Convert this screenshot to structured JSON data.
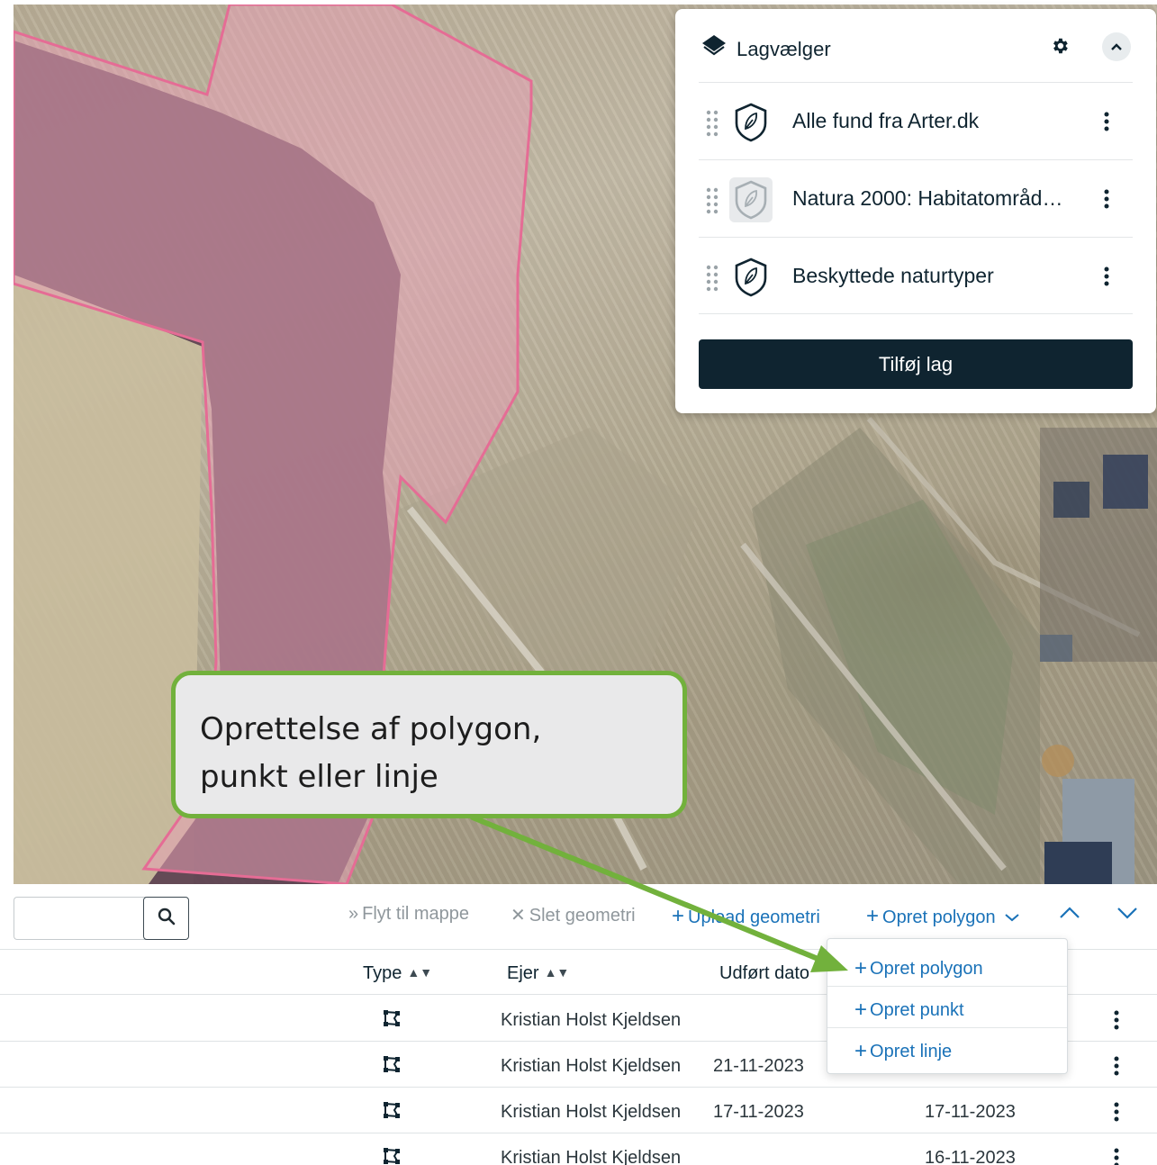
{
  "layer_panel": {
    "title": "Lagvælger",
    "layers": [
      {
        "name": "Alle fund fra Arter.dk",
        "icon": "shield-leaf-icon",
        "dimmed": false
      },
      {
        "name": "Natura 2000: Habitatområd…",
        "icon": "shield-leaf-icon",
        "dimmed": true
      },
      {
        "name": "Beskyttede naturtyper",
        "icon": "shield-leaf-icon",
        "dimmed": false
      }
    ],
    "add_button": "Tilføj lag"
  },
  "callout": {
    "line1": "Oprettelse af polygon,",
    "line2": "punkt eller linje",
    "border_color": "#72b13c"
  },
  "toolbar": {
    "search_value": "",
    "move_to_folder": {
      "glyph": "»",
      "label": "Flyt til mappe"
    },
    "delete_geometry": {
      "glyph": "✕",
      "label": "Slet geometri"
    },
    "upload_geometry": {
      "glyph": "+",
      "label": "Upload geometri"
    },
    "create_polygon": {
      "glyph": "+",
      "label": "Opret polygon"
    }
  },
  "table": {
    "headers": {
      "type": "Type",
      "owner": "Ejer",
      "completed_date": "Udført dato"
    },
    "rows": [
      {
        "owner": "Kristian Holst Kjeldsen",
        "date1": "",
        "date2": ""
      },
      {
        "owner": "Kristian Holst Kjeldsen",
        "date1": "21-11-2023",
        "date2": ""
      },
      {
        "owner": "Kristian Holst Kjeldsen",
        "date1": "17-11-2023",
        "date2": "17-11-2023"
      },
      {
        "owner": "Kristian Holst Kjeldsen",
        "date1": "",
        "date2": "16-11-2023"
      }
    ]
  },
  "dropdown": {
    "items": [
      {
        "glyph": "+",
        "label": "Opret polygon"
      },
      {
        "glyph": "+",
        "label": "Opret punkt"
      },
      {
        "glyph": "+",
        "label": "Opret linje"
      }
    ]
  },
  "colors": {
    "navy": "#0f2430",
    "link_blue": "#1a72b8",
    "polygon_fill": "#e6a0b4",
    "callout_green": "#72b13c"
  }
}
